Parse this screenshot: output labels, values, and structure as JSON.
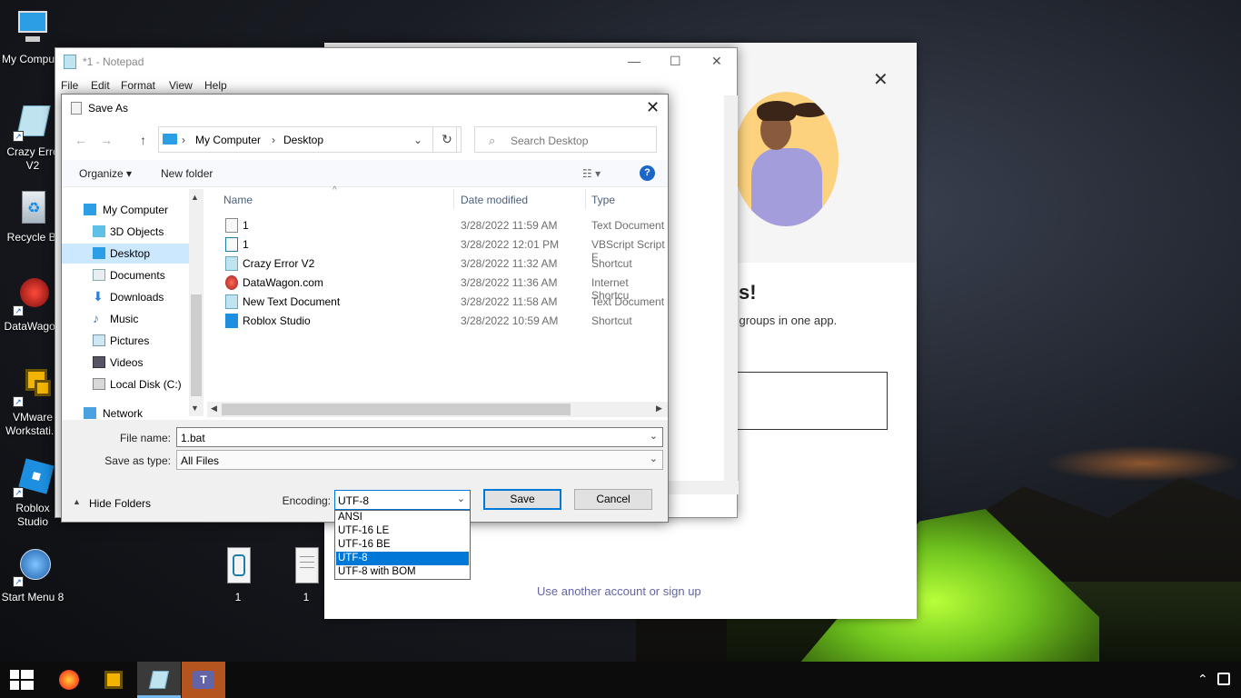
{
  "desktop": {
    "icons": [
      {
        "label": "My Compute"
      },
      {
        "label": "Crazy Erro V2"
      },
      {
        "label": "Recycle Bi"
      },
      {
        "label": "DataWagon"
      },
      {
        "label": "VMware Workstati..."
      },
      {
        "label": "Roblox Studio"
      },
      {
        "label": "Start Menu 8"
      }
    ],
    "files": [
      {
        "label": "1"
      },
      {
        "label": "1"
      }
    ]
  },
  "teams_window": {
    "heading_fragment": "s!",
    "subtext_fragment": "l groups in one app.",
    "link": "Use another account or sign up",
    "close": "✕"
  },
  "notepad": {
    "title": "*1 - Notepad",
    "menu": [
      "File",
      "Edit",
      "Format",
      "View",
      "Help"
    ],
    "controls": {
      "minimize": "—",
      "maximize": "☐",
      "close": "✕"
    }
  },
  "save_dialog": {
    "title": "Save As",
    "close": "✕",
    "nav": {
      "back": "←",
      "forward": "→",
      "up": "↑",
      "refresh": "↻"
    },
    "breadcrumb": [
      "My Computer",
      "Desktop"
    ],
    "search_placeholder": "Search Desktop",
    "toolbar": {
      "organize": "Organize ▾",
      "new_folder": "New folder",
      "help": "?"
    },
    "tree": [
      {
        "label": "My Computer",
        "icon": "computer-icon"
      },
      {
        "label": "3D Objects",
        "icon": "cube-icon"
      },
      {
        "label": "Desktop",
        "icon": "desktop-icon",
        "selected": true
      },
      {
        "label": "Documents",
        "icon": "document-icon"
      },
      {
        "label": "Downloads",
        "icon": "download-icon"
      },
      {
        "label": "Music",
        "icon": "music-icon"
      },
      {
        "label": "Pictures",
        "icon": "picture-icon"
      },
      {
        "label": "Videos",
        "icon": "video-icon"
      },
      {
        "label": "Local Disk (C:)",
        "icon": "disk-icon"
      },
      {
        "label": "Network",
        "icon": "network-icon"
      }
    ],
    "columns": {
      "name": "Name",
      "date": "Date modified",
      "type": "Type"
    },
    "files": [
      {
        "name": "1",
        "date": "3/28/2022 11:59 AM",
        "type": "Text Document",
        "icon": "text-file-icon"
      },
      {
        "name": "1",
        "date": "3/28/2022 12:01 PM",
        "type": "VBScript Script F",
        "icon": "script-file-icon"
      },
      {
        "name": "Crazy Error V2",
        "date": "3/28/2022 11:32 AM",
        "type": "Shortcut",
        "icon": "shortcut-icon"
      },
      {
        "name": "DataWagon.com",
        "date": "3/28/2022 11:36 AM",
        "type": "Internet Shortcu",
        "icon": "web-shortcut-icon"
      },
      {
        "name": "New Text Document",
        "date": "3/28/2022 11:58 AM",
        "type": "Text Document",
        "icon": "text-file-icon"
      },
      {
        "name": "Roblox Studio",
        "date": "3/28/2022 10:59 AM",
        "type": "Shortcut",
        "icon": "roblox-icon"
      }
    ],
    "file_name_label": "File name:",
    "file_name_value": "1.bat",
    "save_type_label": "Save as type:",
    "save_type_value": "All Files",
    "hide_folders": "Hide Folders",
    "encoding_label": "Encoding:",
    "encoding_value": "UTF-8",
    "encoding_options": [
      "ANSI",
      "UTF-16 LE",
      "UTF-16 BE",
      "UTF-8",
      "UTF-8 with BOM"
    ],
    "encoding_selected_index": 3,
    "save_button": "Save",
    "cancel_button": "Cancel"
  },
  "colors": {
    "accent": "#0078d7",
    "selection": "#cce8ff",
    "teams": "#6264a7"
  }
}
